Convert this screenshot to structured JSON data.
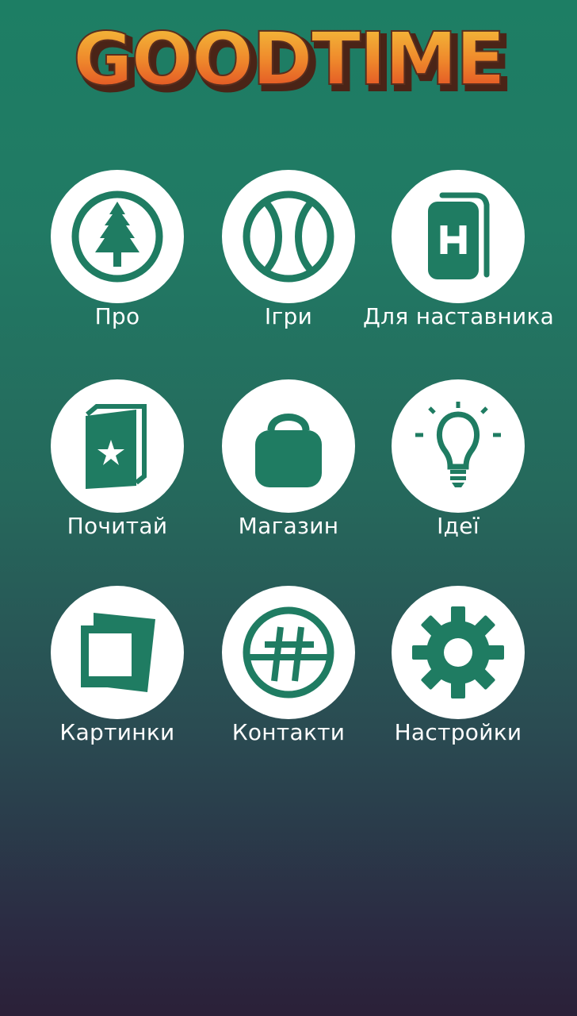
{
  "app": {
    "logo_text": "GOODTIME"
  },
  "colors": {
    "icon": "#1f7c62",
    "circle": "#ffffff",
    "logo_fill_top": "#f2c23a",
    "logo_fill_bottom": "#e04a24",
    "logo_shadow": "#5a2e1e"
  },
  "menu": {
    "items": [
      {
        "label": "Про",
        "icon": "tree-icon"
      },
      {
        "label": "Ігри",
        "icon": "ball-icon"
      },
      {
        "label": "Для наставника",
        "icon": "mentor-book-icon"
      },
      {
        "label": "Почитай",
        "icon": "star-book-icon"
      },
      {
        "label": "Магазин",
        "icon": "shopping-bag-icon"
      },
      {
        "label": "Ідеї",
        "icon": "lightbulb-icon"
      },
      {
        "label": "Картинки",
        "icon": "pictures-icon"
      },
      {
        "label": "Контакти",
        "icon": "hashtag-icon"
      },
      {
        "label": "Настройки",
        "icon": "gear-icon"
      }
    ]
  }
}
